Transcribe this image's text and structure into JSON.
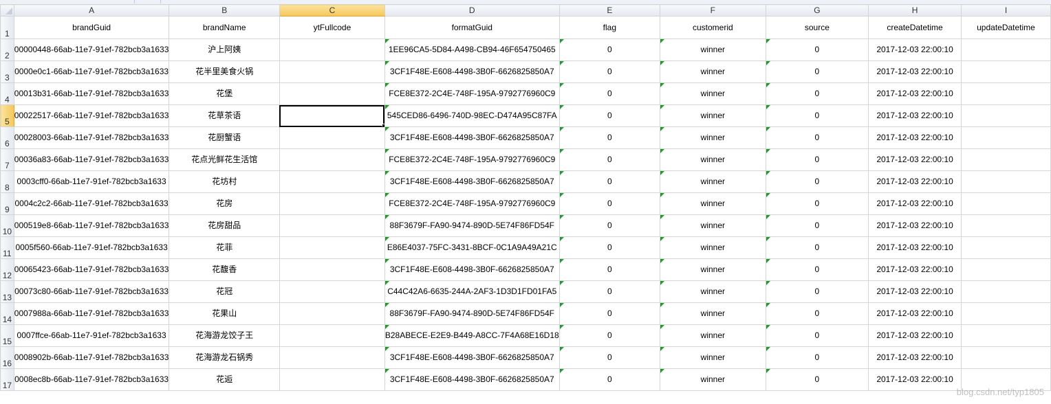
{
  "columns": [
    "A",
    "B",
    "C",
    "D",
    "E",
    "F",
    "G",
    "H",
    "I"
  ],
  "selected_column": "C",
  "selected_row": "5",
  "header_row": {
    "number": "1",
    "cells": [
      "brandGuid",
      "brandName",
      "ytFullcode",
      "formatGuid",
      "flag",
      "customerid",
      "source",
      "createDatetime",
      "updateDatetime"
    ]
  },
  "rows": [
    {
      "num": "2",
      "cells": [
        "00000448-66ab-11e7-91ef-782bcb3a1633",
        "沪上阿姨",
        "",
        "1EE96CA5-5D84-A498-CB94-46F654750465",
        "0",
        "winner",
        "0",
        "2017-12-03 22:00:10",
        ""
      ]
    },
    {
      "num": "3",
      "cells": [
        "0000e0c1-66ab-11e7-91ef-782bcb3a1633",
        "花半里美食火锅",
        "",
        "3CF1F48E-E608-4498-3B0F-6626825850A7",
        "0",
        "winner",
        "0",
        "2017-12-03 22:00:10",
        ""
      ]
    },
    {
      "num": "4",
      "cells": [
        "00013b31-66ab-11e7-91ef-782bcb3a1633",
        "花堡",
        "",
        "FCE8E372-2C4E-748F-195A-9792776960C9",
        "0",
        "winner",
        "0",
        "2017-12-03 22:00:10",
        ""
      ]
    },
    {
      "num": "5",
      "cells": [
        "00022517-66ab-11e7-91ef-782bcb3a1633",
        "花草茶语",
        "",
        "545CED86-6496-740D-98EC-D474A95C87FA",
        "0",
        "winner",
        "0",
        "2017-12-03 22:00:10",
        ""
      ]
    },
    {
      "num": "6",
      "cells": [
        "00028003-66ab-11e7-91ef-782bcb3a1633",
        "花厨蟹语",
        "",
        "3CF1F48E-E608-4498-3B0F-6626825850A7",
        "0",
        "winner",
        "0",
        "2017-12-03 22:00:10",
        ""
      ]
    },
    {
      "num": "7",
      "cells": [
        "00036a83-66ab-11e7-91ef-782bcb3a1633",
        "花点光鲜花生活馆",
        "",
        "FCE8E372-2C4E-748F-195A-9792776960C9",
        "0",
        "winner",
        "0",
        "2017-12-03 22:00:10",
        ""
      ]
    },
    {
      "num": "8",
      "cells": [
        "0003cff0-66ab-11e7-91ef-782bcb3a1633",
        "花坊村",
        "",
        "3CF1F48E-E608-4498-3B0F-6626825850A7",
        "0",
        "winner",
        "0",
        "2017-12-03 22:00:10",
        ""
      ]
    },
    {
      "num": "9",
      "cells": [
        "0004c2c2-66ab-11e7-91ef-782bcb3a1633",
        "花房",
        "",
        "FCE8E372-2C4E-748F-195A-9792776960C9",
        "0",
        "winner",
        "0",
        "2017-12-03 22:00:10",
        ""
      ]
    },
    {
      "num": "10",
      "cells": [
        "000519e8-66ab-11e7-91ef-782bcb3a1633",
        "花房甜品",
        "",
        "88F3679F-FA90-9474-890D-5E74F86FD54F",
        "0",
        "winner",
        "0",
        "2017-12-03 22:00:10",
        ""
      ]
    },
    {
      "num": "11",
      "cells": [
        "0005f560-66ab-11e7-91ef-782bcb3a1633",
        "花菲",
        "",
        "E86E4037-75FC-3431-8BCF-0C1A9A49A21C",
        "0",
        "winner",
        "0",
        "2017-12-03 22:00:10",
        ""
      ]
    },
    {
      "num": "12",
      "cells": [
        "00065423-66ab-11e7-91ef-782bcb3a1633",
        "花馥香",
        "",
        "3CF1F48E-E608-4498-3B0F-6626825850A7",
        "0",
        "winner",
        "0",
        "2017-12-03 22:00:10",
        ""
      ]
    },
    {
      "num": "13",
      "cells": [
        "00073c80-66ab-11e7-91ef-782bcb3a1633",
        "花冠",
        "",
        "C44C42A6-6635-244A-2AF3-1D3D1FD01FA5",
        "0",
        "winner",
        "0",
        "2017-12-03 22:00:10",
        ""
      ]
    },
    {
      "num": "14",
      "cells": [
        "0007988a-66ab-11e7-91ef-782bcb3a1633",
        "花果山",
        "",
        "88F3679F-FA90-9474-890D-5E74F86FD54F",
        "0",
        "winner",
        "0",
        "2017-12-03 22:00:10",
        ""
      ]
    },
    {
      "num": "15",
      "cells": [
        "0007ffce-66ab-11e7-91ef-782bcb3a1633",
        "花海游龙饺子王",
        "",
        "B28ABECE-E2E9-B449-A8CC-7F4A68E16D18",
        "0",
        "winner",
        "0",
        "2017-12-03 22:00:10",
        ""
      ]
    },
    {
      "num": "16",
      "cells": [
        "0008902b-66ab-11e7-91ef-782bcb3a1633",
        "花海游龙石锅秀",
        "",
        "3CF1F48E-E608-4498-3B0F-6626825850A7",
        "0",
        "winner",
        "0",
        "2017-12-03 22:00:10",
        ""
      ]
    },
    {
      "num": "17",
      "cells": [
        "0008ec8b-66ab-11e7-91ef-782bcb3a1633",
        "花逅",
        "",
        "3CF1F48E-E608-4498-3B0F-6626825850A7",
        "0",
        "winner",
        "0",
        "2017-12-03 22:00:10",
        ""
      ]
    }
  ],
  "watermark": "blog.csdn.net/typ1805"
}
